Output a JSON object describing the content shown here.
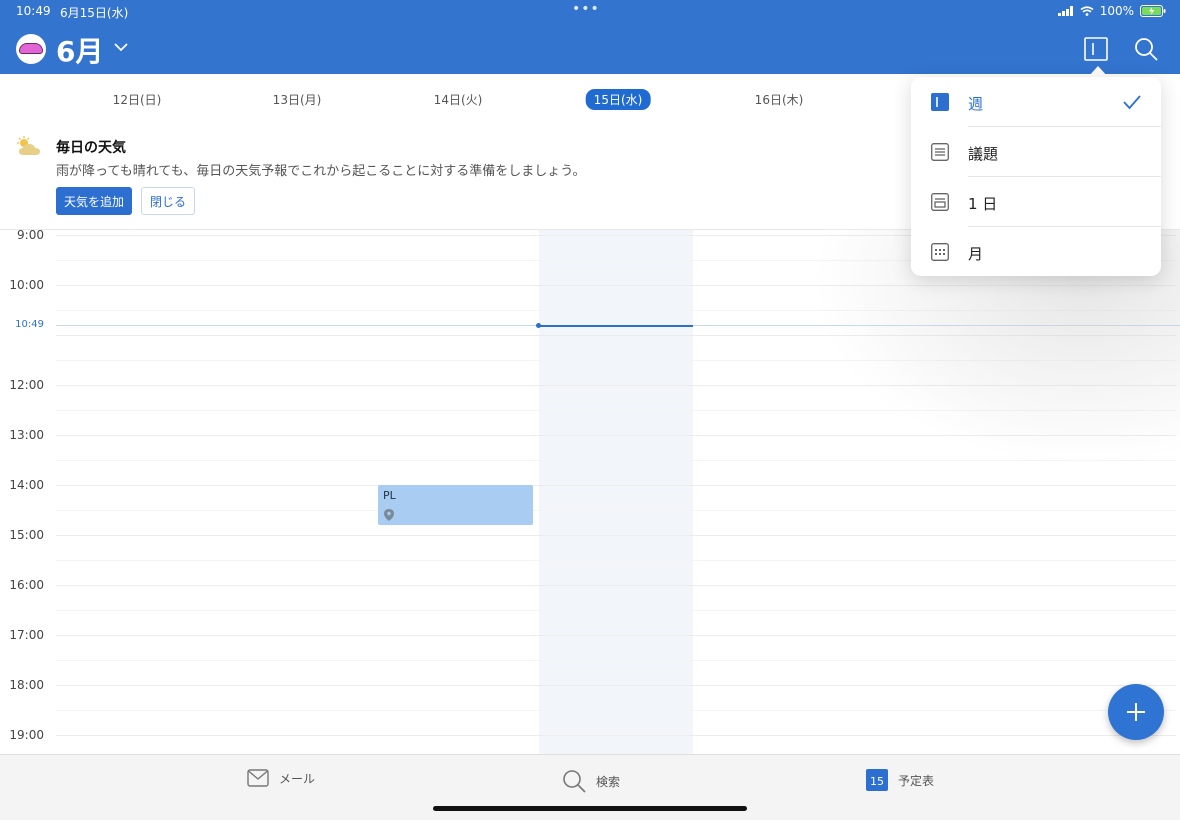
{
  "status_bar": {
    "time": "10:49",
    "date": "6月15日(水)",
    "battery": "100%"
  },
  "header": {
    "month": "6月"
  },
  "days": [
    {
      "label": "12日(日)",
      "today": false
    },
    {
      "label": "13日(月)",
      "today": false
    },
    {
      "label": "14日(火)",
      "today": false
    },
    {
      "label": "15日(水)",
      "today": true
    },
    {
      "label": "16日(木)",
      "today": false
    }
  ],
  "weather_banner": {
    "title": "毎日の天気",
    "text": "雨が降っても晴れても、毎日の天気予報でこれから起こることに対する準備をしましょう。",
    "add_button": "天気を追加",
    "close_button": "閉じる"
  },
  "time_labels": [
    "9:00",
    "10:00",
    "12:00",
    "13:00",
    "14:00",
    "15:00",
    "16:00",
    "17:00",
    "18:00",
    "19:00"
  ],
  "now_label": "10:49",
  "event": {
    "title": "PL"
  },
  "view_menu": {
    "items": [
      {
        "label": "週",
        "icon": "week-view-icon",
        "selected": true
      },
      {
        "label": "議題",
        "icon": "agenda-icon",
        "selected": false
      },
      {
        "label": "1 日",
        "icon": "day-view-icon",
        "selected": false
      },
      {
        "label": "月",
        "icon": "month-view-icon",
        "selected": false
      }
    ]
  },
  "tabbar": {
    "mail": "メール",
    "search": "検索",
    "calendar": "予定表",
    "calendar_day": "15"
  },
  "colors": {
    "brand": "#3374cf",
    "accent": "#2c6fd0",
    "event": "#a9cdf2"
  }
}
